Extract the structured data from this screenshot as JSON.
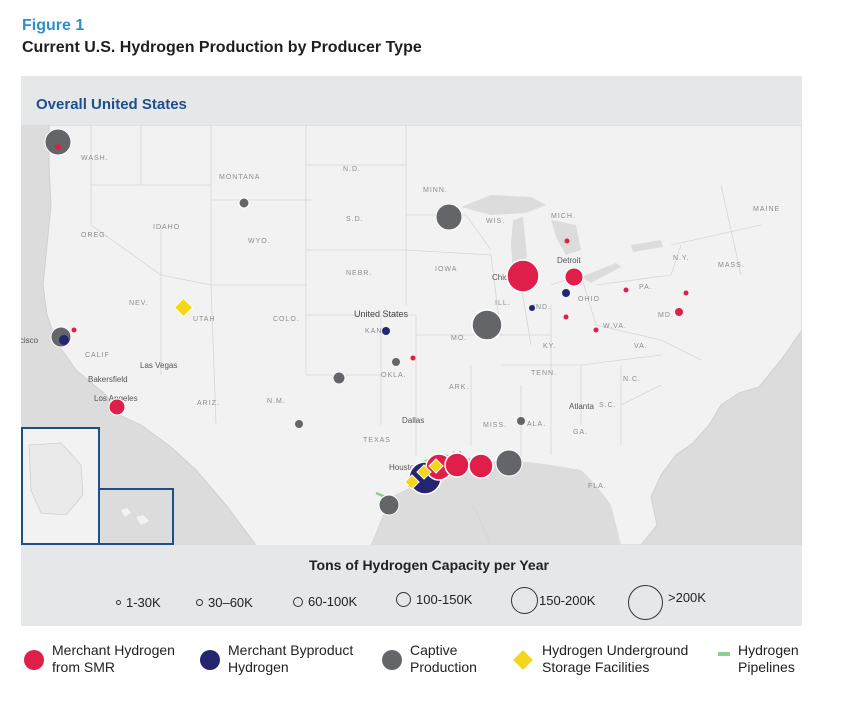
{
  "figure": {
    "label": "Figure 1",
    "title": "Current U.S. Hydrogen Production by Producer Type",
    "panel_title": "Overall United States"
  },
  "map": {
    "country_label": "United States",
    "state_labels": [
      "WASH.",
      "MONTANA",
      "N.D.",
      "MINN.",
      "OREG.",
      "IDAHO",
      "S.D.",
      "WIS.",
      "MICH.",
      "WYO.",
      "NEBR.",
      "IOWA",
      "NEV.",
      "UTAH",
      "COLO.",
      "KANS.",
      "MO.",
      "ILL.",
      "IND.",
      "OHIO",
      "PA.",
      "N.Y.",
      "MAINE",
      "MASS.",
      "CALIF",
      "ARIZ.",
      "N.M.",
      "OKLA.",
      "ARK.",
      "TENN.",
      "KY.",
      "W.VA.",
      "VA.",
      "N.C.",
      "S.C.",
      "GA.",
      "ALA.",
      "MISS.",
      "LA.",
      "TEXAS",
      "FLA.",
      "MD."
    ],
    "city_labels": [
      "Las Vegas",
      "Bakersfield",
      "Los Angeles",
      "San Francisco",
      "Dallas",
      "Houston",
      "Chicago",
      "Detroit",
      "Atlanta"
    ],
    "colors": {
      "merchant_smr": "#e01e4a",
      "merchant_byproduct": "#23256e",
      "captive": "#636569",
      "storage": "#f2d71d",
      "pipeline": "#8ccf8f"
    }
  },
  "size_legend": {
    "title": "Tons of Hydrogen Capacity per Year",
    "items": [
      "1-30K",
      "30–60K",
      "60-100K",
      "100-150K",
      "150-200K",
      ">200K"
    ]
  },
  "legend": {
    "items": [
      {
        "label": "Merchant Hydrogen\nfrom SMR",
        "icon": "red-circle"
      },
      {
        "label": "Merchant Byproduct\nHydrogen",
        "icon": "navy-circle"
      },
      {
        "label": "Captive\nProduction",
        "icon": "gray-circle"
      },
      {
        "label": "Hydrogen Underground\nStorage Facilities",
        "icon": "yellow-diamond"
      },
      {
        "label": "Hydrogen\nPipelines",
        "icon": "green-line"
      }
    ]
  }
}
